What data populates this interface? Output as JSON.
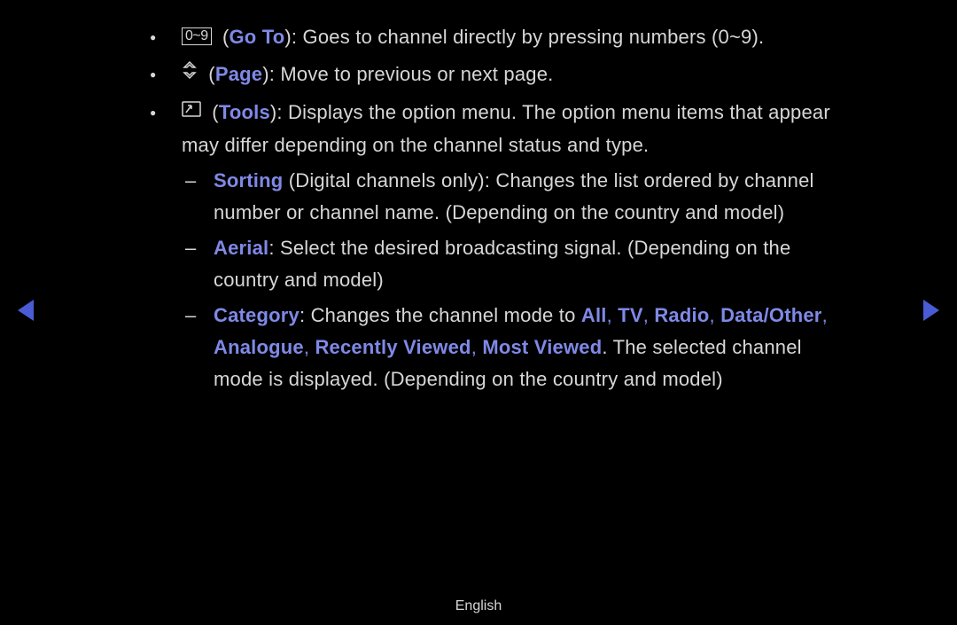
{
  "items": [
    {
      "icon_label": "0~9",
      "key": "Go To",
      "desc": "): Goes to channel directly by pressing numbers (0~9)."
    },
    {
      "key": "Page",
      "desc": "): Move to previous or next page."
    },
    {
      "key": "Tools",
      "desc_1": "): Displays the option menu. The option menu items that appear",
      "desc_2": "may differ depending on the channel status and type.",
      "subs": [
        {
          "key": "Sorting",
          "rest_1": " (Digital channels only): Changes the list ordered by channel",
          "rest_2": "number or channel name. (Depending on the country and model)"
        },
        {
          "key": "Aerial",
          "rest_1": ": Select the desired broadcasting signal. (Depending on the",
          "rest_2": "country and model)"
        },
        {
          "key": "Category",
          "plain_a": ": Changes the channel mode to ",
          "m1": "All",
          "m2": "TV",
          "m3": "Radio",
          "m4": "Data/Other",
          "m5": "Analogue",
          "m6": "Recently Viewed",
          "m7": "Most Viewed",
          "tail_1": ". The selected channel",
          "tail_2": "mode is displayed. (Depending on the country and model)",
          "comma": ", "
        }
      ]
    }
  ],
  "footer": "English"
}
